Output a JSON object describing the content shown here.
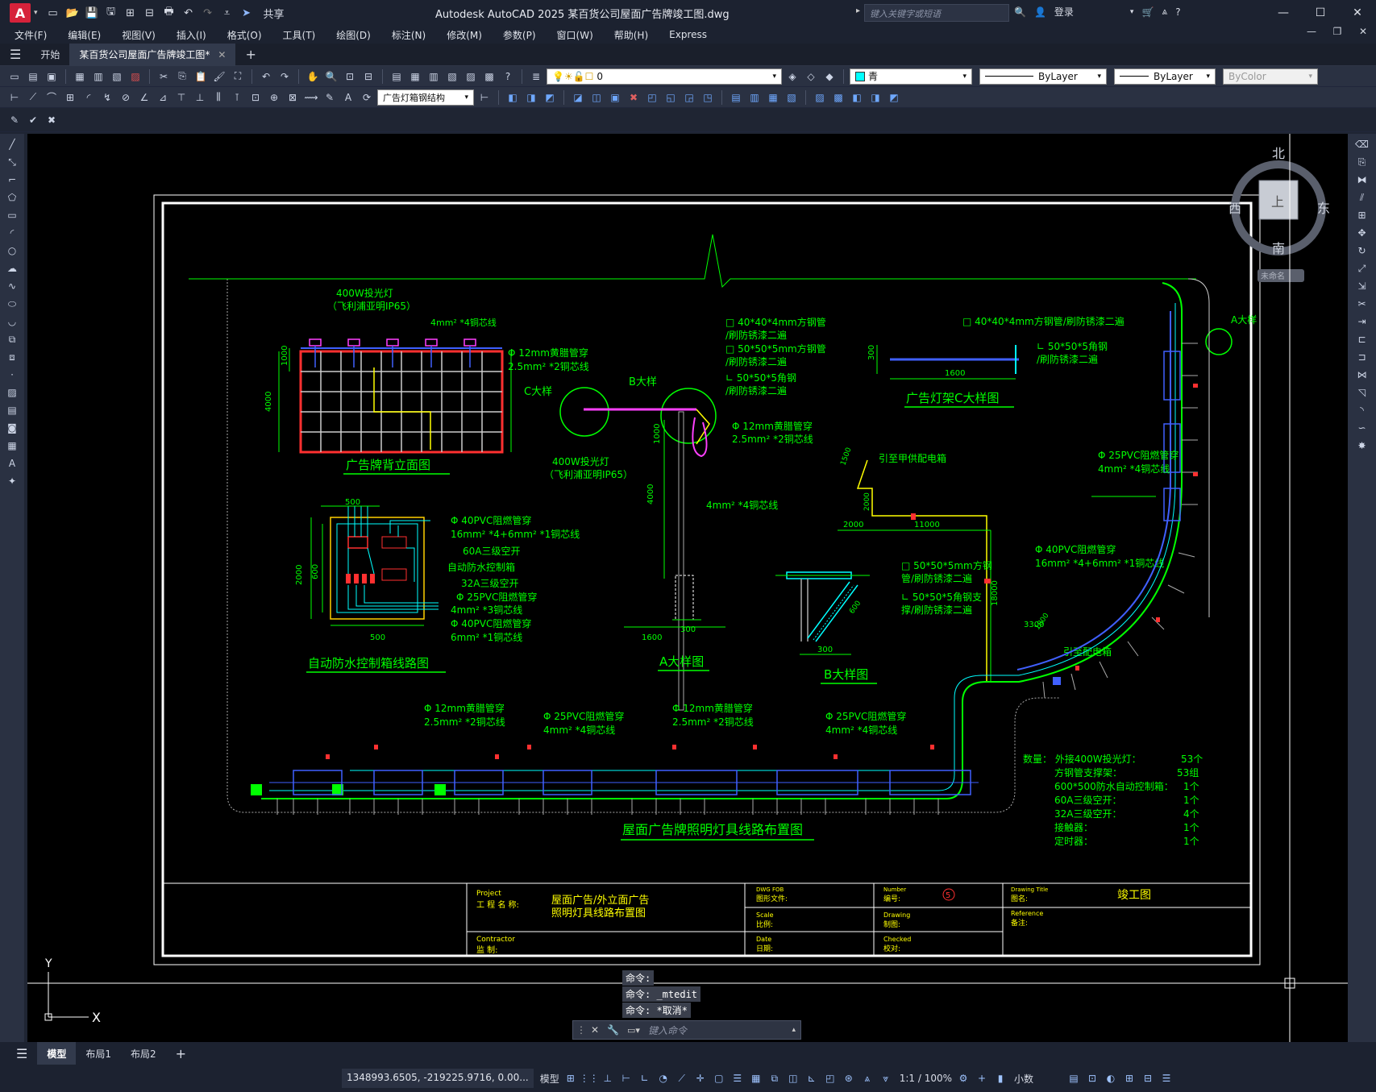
{
  "app": {
    "logo": "A",
    "title": "Autodesk AutoCAD 2025    某百货公司屋面广告牌竣工图.dwg",
    "share": "共享",
    "search_placeholder": "键入关键字或短语",
    "login": "登录"
  },
  "menu": [
    "文件(F)",
    "编辑(E)",
    "视图(V)",
    "插入(I)",
    "格式(O)",
    "工具(T)",
    "绘图(D)",
    "标注(N)",
    "修改(M)",
    "参数(P)",
    "窗口(W)",
    "帮助(H)",
    "Express"
  ],
  "tabs": {
    "start": "开始",
    "doc": "某百货公司屋面广告牌竣工图*",
    "add": "+"
  },
  "layers": {
    "current": "0",
    "color": "青",
    "linetype": "ByLayer",
    "lineweight": "ByLayer",
    "plotstyle": "ByColor",
    "block_name": "广告灯箱钢结构"
  },
  "viewcube": {
    "north": "北",
    "south": "南",
    "east": "东",
    "west": "西",
    "top": "上",
    "wcs": "未命名"
  },
  "drawing": {
    "main_title": "屋面广告牌照明灯具线路布置图",
    "back_elevation_title": "广告牌背立面图",
    "control_box_title": "自动防水控制箱线路图",
    "detail_a_title": "A大样图",
    "detail_b_title": "B大样图",
    "detail_c_title": "广告灯架C大样图",
    "labels": {
      "lamp1": "400W投光灯",
      "lamp1b": "（飞利浦亚明IP65）",
      "wire4": "4mm² *4铜芯线",
      "pipe12": "Φ 12mm黄腊管穿",
      "wire25": "2.5mm² *2铜芯线",
      "c_detail": "C大样",
      "b_detail": "B大样",
      "a_detail": "A大样",
      "lamp2": "400W投光灯",
      "lamp2b": "（飞利浦亚明IP65）",
      "sq40": "□ 40*40*4mm方钢管",
      "paint1": "/刷防锈漆二遍",
      "sq50": "□ 50*50*5mm方钢管",
      "paint2": "/刷防锈漆二遍",
      "ang50": "∟ 50*50*5角钢",
      "paint3": "/刷防锈漆二遍",
      "pipe12b": "Φ 12mm黄腊管穿",
      "wire25b": "2.5mm² *2铜芯线",
      "wire4b": "4mm² *4铜芯线",
      "c_sq40": "□ 40*40*4mm方钢管/刷防锈漆二遍",
      "c_ang": "∟ 50*50*5角钢",
      "c_paint": "/刷防锈漆二遍",
      "to_supply": "引至甲供配电箱",
      "to_box": "引至配电箱",
      "pvc40": "Φ 40PVC阻燃管穿",
      "w16": "16mm² *4+6mm² *1铜芯线",
      "sw60": "60A三级空开",
      "auto_box": "自动防水控制箱",
      "sw32": "32A三级空开",
      "pvc25": "Φ 25PVC阻燃管穿",
      "w4x3": "4mm² *3铜芯线",
      "pvc40b": "Φ 40PVC阻燃管穿",
      "w6": "6mm² *1铜芯线",
      "b_sq50": "□ 50*50*5mm方钢",
      "b_paint1": "管/刷防锈漆二遍",
      "b_ang": "∟ 50*50*5角钢支",
      "b_paint2": "撑/刷防锈漆二遍",
      "r_pvc25": "Φ 25PVC阻燃管穿",
      "r_w4": "4mm² *4铜芯线",
      "r_pvc40": "Φ 40PVC阻燃管穿",
      "r_w16": "16mm² *4+6mm² *1铜芯线",
      "bt_pipe12a": "Φ 12mm黄腊管穿",
      "bt_w25a": "2.5mm² *2铜芯线",
      "bt_pvc25a": "Φ 25PVC阻燃管穿",
      "bt_w4a": "4mm² *4铜芯线",
      "bt_pipe12b": "Φ 12mm黄腊管穿",
      "bt_w25b": "2.5mm² *2铜芯线",
      "bt_pvc25b": "Φ 25PVC阻燃管穿",
      "bt_w4b": "4mm² *4铜芯线",
      "contactor": "接触器",
      "timer": "定时器"
    },
    "dims": {
      "d1000": "1000",
      "d4000": "4000",
      "d500": "500",
      "d2000": "2000",
      "d600": "600",
      "d500b": "500",
      "d1000b": "1000",
      "d4000b": "4000",
      "d1600": "1600",
      "d300": "300",
      "d300c": "300",
      "d1600c": "1600",
      "d1500": "1500",
      "d2000b": "2000",
      "d2000c": "2000",
      "d11000": "11000",
      "d18000": "18000",
      "d3300": "3300",
      "d1800": "1800",
      "d600b": "600",
      "d300b": "300"
    },
    "quantities": [
      {
        "label": "数量：  外接400W投光灯：",
        "value": "53个"
      },
      {
        "label": "方钢管支撑架：",
        "value": "53组"
      },
      {
        "label": "600*500防水自动控制箱：",
        "value": "1个"
      },
      {
        "label": "60A三级空开：",
        "value": "1个"
      },
      {
        "label": "32A三级空开：",
        "value": "4个"
      },
      {
        "label": "接触器：",
        "value": "1个"
      },
      {
        "label": "定时器：",
        "value": "1个"
      }
    ],
    "titleblock": {
      "project_en": "Project",
      "project_cn": "工 程 名 称:",
      "project_name1": "屋面广告/外立面广告",
      "project_name2": "照明灯具线路布置图",
      "contractor_en": "Contractor",
      "contractor_cn": "监 制:",
      "dwg_en": "DWG FOB",
      "dwg_cn": "图形文件:",
      "scale_en": "Scale",
      "scale_cn": "比例:",
      "date_en": "Date",
      "date_cn": "日期:",
      "number_en": "Number",
      "number_cn": "编号:",
      "number_val": "5",
      "drawing_en": "Drawing",
      "drawing_cn": "制图:",
      "checked_en": "Checked",
      "checked_cn": "校对:",
      "title_en": "Drawing  Title",
      "title_cn": "图名:",
      "title_val": "竣工图",
      "ref_en": "Reference",
      "ref_cn": "备注:"
    }
  },
  "command": {
    "hist1": "命令:",
    "hist2": "命令: _mtedit",
    "hist3": "命令: *取消*",
    "placeholder": "键入命令"
  },
  "layout_tabs": {
    "model": "模型",
    "layout1": "布局1",
    "layout2": "布局2",
    "add": "+"
  },
  "status": {
    "coords": "1348993.6505, -219225.9716, 0.00...",
    "model": "模型",
    "scale": "1:1 / 100%",
    "units": "小数"
  },
  "ucs": {
    "x": "X",
    "y": "Y"
  }
}
